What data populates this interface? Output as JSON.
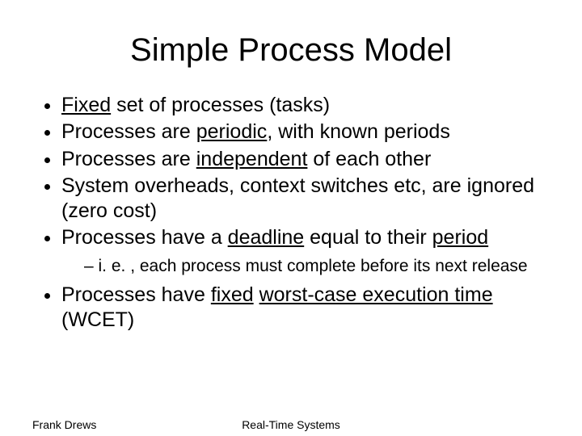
{
  "title": "Simple Process Model",
  "bullets": {
    "b1_pre": "",
    "b1_fixed": "Fixed",
    "b1_post": " set of processes (tasks)",
    "b2_pre": "Processes are ",
    "b2_periodic": "periodic",
    "b2_post": ", with known periods",
    "b3_pre": "Processes are ",
    "b3_ind": "independent",
    "b3_post": " of each other",
    "b4": "System overheads, context switches etc, are ignored (zero cost)",
    "b5_pre": "Processes have a ",
    "b5_deadline": "deadline",
    "b5_mid": " equal to their ",
    "b5_period": "period",
    "b5_sub": "i. e. , each process must complete before its next release",
    "b6_pre": "Processes have ",
    "b6_fixed": "fixed",
    "b6_sp": " ",
    "b6_wcet": "worst-case execution time",
    "b6_post": " (WCET)"
  },
  "footer": {
    "left": "Frank Drews",
    "center": "Real-Time Systems"
  }
}
